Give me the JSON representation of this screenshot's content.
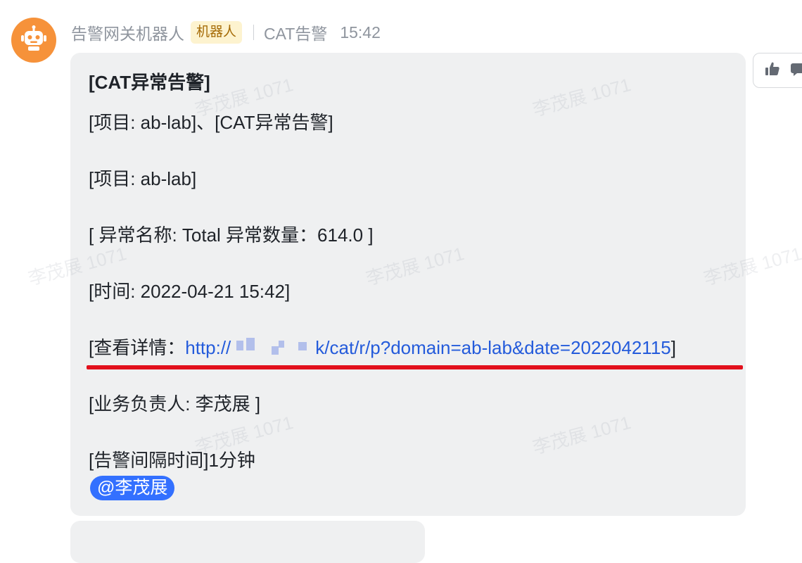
{
  "header": {
    "sender": "告警网关机器人",
    "badge": "机器人",
    "group": "CAT告警",
    "time": "15:42"
  },
  "message": {
    "title": "[CAT异常告警]",
    "line_project_alert": "[项目: ab-lab]、[CAT异常告警]",
    "line_project": "[项目: ab-lab]",
    "line_exception": "[ 异常名称: Total 异常数量：614.0 ]",
    "line_time": "[时间: 2022-04-21 15:42]",
    "detail_prefix": "[查看详情：",
    "detail_link_start": "http://",
    "detail_link_end": "k/cat/r/p?domain=ab-lab&date=2022042115",
    "detail_suffix": "]",
    "line_owner": "[业务负责人: 李茂展 ]",
    "line_interval": "[告警间隔时间]1分钟",
    "mention": "@李茂展"
  },
  "watermark": "李茂展 1071",
  "icons": {
    "avatar": "robot-icon",
    "reaction": "thumbs-up-icon",
    "more": "reply-icon"
  },
  "colors": {
    "avatar_bg": "#f6923a",
    "badge_bg": "#fdf3cf",
    "badge_text": "#a56b06",
    "link": "#245bdb",
    "mention_bg": "#3370ff",
    "highlight_underline": "#e2101c",
    "bubble_bg": "#eff0f1"
  }
}
